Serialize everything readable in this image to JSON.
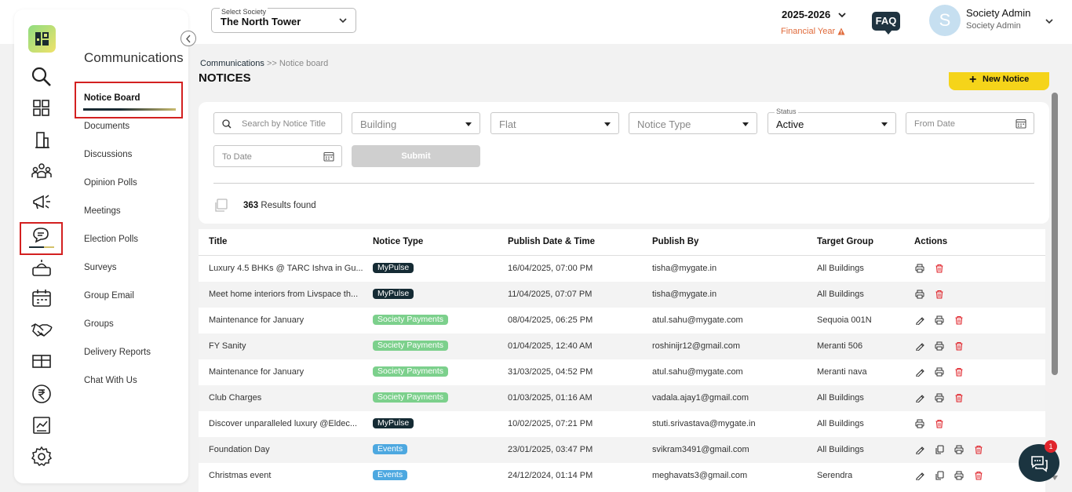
{
  "header": {
    "society_label": "Select Society",
    "society_value": "The North Tower",
    "year": "2025-2026",
    "year_sublabel": "Financial Year",
    "faq": "FAQ",
    "user_initial": "S",
    "user_name": "Society Admin",
    "user_role": "Society Admin"
  },
  "sidebar": {
    "module_title": "Communications",
    "rail_icons": [
      "search-icon",
      "dashboard-grid-icon",
      "building-icon",
      "community-icon",
      "megaphone-icon",
      "chat-icon",
      "helpdesk-icon",
      "calendar-icon",
      "handshake-icon",
      "amenity-icon",
      "rupee-icon",
      "report-icon",
      "settings-icon"
    ],
    "items": [
      {
        "label": "Notice Board",
        "active": true
      },
      {
        "label": "Documents"
      },
      {
        "label": "Discussions"
      },
      {
        "label": "Opinion Polls"
      },
      {
        "label": "Meetings"
      },
      {
        "label": "Election Polls"
      },
      {
        "label": "Surveys"
      },
      {
        "label": "Group Email"
      },
      {
        "label": "Groups"
      },
      {
        "label": "Delivery Reports"
      },
      {
        "label": "Chat With Us"
      }
    ]
  },
  "breadcrumb": {
    "root": "Communications",
    "sep": " >> ",
    "current": "Notice board"
  },
  "page_title": "NOTICES",
  "new_notice_label": "New Notice",
  "filters": {
    "search_placeholder": "Search by Notice Title",
    "building_placeholder": "Building",
    "flat_placeholder": "Flat",
    "notice_type_placeholder": "Notice Type",
    "status_label": "Status",
    "status_value": "Active",
    "from_date_placeholder": "From Date",
    "to_date_placeholder": "To Date",
    "submit_label": "Submit"
  },
  "results": {
    "count": "363",
    "label": " Results found"
  },
  "table": {
    "columns": [
      "Title",
      "Notice Type",
      "Publish Date & Time",
      "Publish By",
      "Target Group",
      "Actions"
    ],
    "rows": [
      {
        "title": "Luxury 4.5 BHKs @ TARC Ishva in Gu...",
        "type": "MyPulse",
        "date": "16/04/2025, 07:00 PM",
        "by": "tisha@mygate.in",
        "target": "All Buildings",
        "actions": [
          "print",
          "delete"
        ]
      },
      {
        "title": "Meet home interiors from Livspace th...",
        "type": "MyPulse",
        "date": "11/04/2025, 07:07 PM",
        "by": "tisha@mygate.in",
        "target": "All Buildings",
        "actions": [
          "print",
          "delete"
        ]
      },
      {
        "title": "Maintenance for January",
        "type": "Society Payments",
        "date": "08/04/2025, 06:25 PM",
        "by": "atul.sahu@mygate.com",
        "target": "Sequoia 001N",
        "actions": [
          "edit",
          "print",
          "delete"
        ]
      },
      {
        "title": "FY Sanity",
        "type": "Society Payments",
        "date": "01/04/2025, 12:40 AM",
        "by": "roshinijr12@gmail.com",
        "target": "Meranti 506",
        "actions": [
          "edit",
          "print",
          "delete"
        ]
      },
      {
        "title": "Maintenance for January",
        "type": "Society Payments",
        "date": "31/03/2025, 04:52 PM",
        "by": "atul.sahu@mygate.com",
        "target": "Meranti nava",
        "actions": [
          "edit",
          "print",
          "delete"
        ]
      },
      {
        "title": "Club Charges",
        "type": "Society Payments",
        "date": "01/03/2025, 01:16 AM",
        "by": "vadala.ajay1@gmail.com",
        "target": "All Buildings",
        "actions": [
          "edit",
          "print",
          "delete"
        ]
      },
      {
        "title": "Discover unparalleled luxury @Eldec...",
        "type": "MyPulse",
        "date": "10/02/2025, 07:21 PM",
        "by": "stuti.srivastava@mygate.in",
        "target": "All Buildings",
        "actions": [
          "print",
          "delete"
        ]
      },
      {
        "title": "Foundation Day",
        "type": "Events",
        "date": "23/01/2025, 03:47 PM",
        "by": "svikram3491@gmail.com",
        "target": "All Buildings",
        "actions": [
          "edit",
          "copy",
          "print",
          "delete"
        ]
      },
      {
        "title": "Christmas event",
        "type": "Events",
        "date": "24/12/2024, 01:14 PM",
        "by": "meghavats3@gmail.com",
        "target": "Serendra",
        "actions": [
          "edit",
          "copy",
          "print",
          "delete"
        ]
      }
    ]
  },
  "chat_badge": "1",
  "colors": {
    "accent_yellow": "#f5d41a",
    "dark": "#1b3440",
    "delete_red": "#e0242b",
    "payments_green": "#7cd08c",
    "events_blue": "#4da8e0"
  }
}
